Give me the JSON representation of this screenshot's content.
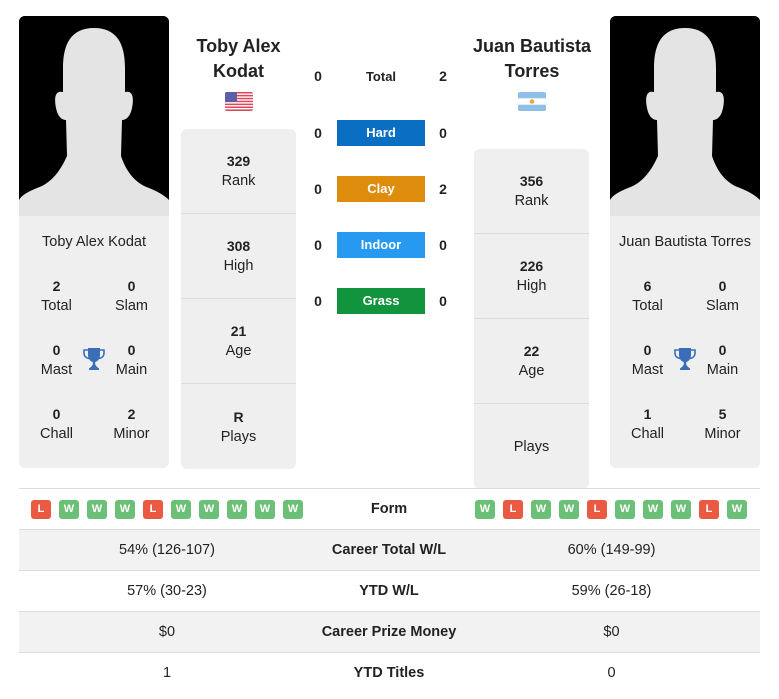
{
  "players": [
    {
      "name": "Toby Alex Kodat",
      "header_name_line1": "Toby Alex",
      "header_name_line2": "Kodat",
      "flag": "usa-flag-icon",
      "titles": {
        "total": "2",
        "total_label": "Total",
        "slam": "0",
        "slam_label": "Slam",
        "mast": "0",
        "mast_label": "Mast",
        "main": "0",
        "main_label": "Main",
        "chall": "0",
        "chall_label": "Chall",
        "minor": "2",
        "minor_label": "Minor"
      },
      "stats": [
        {
          "value": "329",
          "label": "Rank"
        },
        {
          "value": "308",
          "label": "High"
        },
        {
          "value": "21",
          "label": "Age"
        },
        {
          "value": "R",
          "label": "Plays"
        }
      ],
      "form": [
        "L",
        "W",
        "W",
        "W",
        "L",
        "W",
        "W",
        "W",
        "W",
        "W"
      ],
      "career_wl": "54% (126-107)",
      "ytd_wl": "57% (30-23)",
      "prize": "$0",
      "ytd_titles": "1"
    },
    {
      "name": "Juan Bautista Torres",
      "header_name_line1": "Juan Bautista",
      "header_name_line2": "Torres",
      "flag": "argentina-flag-icon",
      "titles": {
        "total": "6",
        "total_label": "Total",
        "slam": "0",
        "slam_label": "Slam",
        "mast": "0",
        "mast_label": "Mast",
        "main": "0",
        "main_label": "Main",
        "chall": "1",
        "chall_label": "Chall",
        "minor": "5",
        "minor_label": "Minor"
      },
      "stats": [
        {
          "value": "356",
          "label": "Rank"
        },
        {
          "value": "226",
          "label": "High"
        },
        {
          "value": "22",
          "label": "Age"
        },
        {
          "value": "",
          "label": "Plays"
        }
      ],
      "form": [
        "W",
        "L",
        "W",
        "W",
        "L",
        "W",
        "W",
        "W",
        "L",
        "W"
      ],
      "career_wl": "60% (149-99)",
      "ytd_wl": "59% (26-18)",
      "prize": "$0",
      "ytd_titles": "0"
    }
  ],
  "h2h": {
    "total": {
      "label": "Total",
      "p1": "0",
      "p2": "2"
    },
    "surfaces": [
      {
        "label": "Hard",
        "p1": "0",
        "p2": "0",
        "color": "#0a6fc2"
      },
      {
        "label": "Clay",
        "p1": "0",
        "p2": "2",
        "color": "#dd8c0b"
      },
      {
        "label": "Indoor",
        "p1": "0",
        "p2": "0",
        "color": "#2899f0"
      },
      {
        "label": "Grass",
        "p1": "0",
        "p2": "0",
        "color": "#11943d"
      }
    ]
  },
  "table": {
    "form_label": "Form",
    "career_label": "Career Total W/L",
    "ytd_label": "YTD W/L",
    "prize_label": "Career Prize Money",
    "titles_label": "YTD Titles"
  },
  "colors": {
    "win": "#6cbf77",
    "loss": "#ea5a43",
    "trophy": "#3a6fb8"
  }
}
